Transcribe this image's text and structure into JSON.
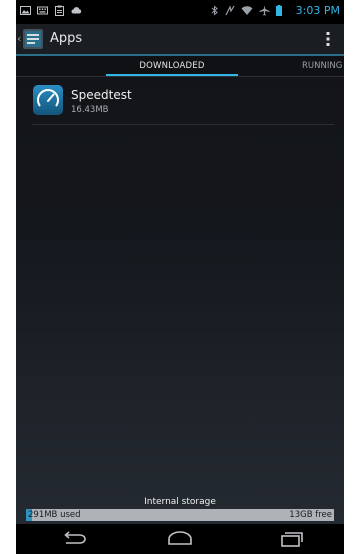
{
  "status_bar": {
    "time": "3:03 PM",
    "notification_icons": [
      "image-icon",
      "keyboard-icon",
      "clipboard-icon",
      "cloud-sync-icon"
    ],
    "system_icons": [
      "bluetooth-icon",
      "nfc-icon",
      "wifi-icon",
      "airplane-icon",
      "battery-icon"
    ]
  },
  "action_bar": {
    "title": "Apps"
  },
  "tabs": [
    {
      "label": "DOWNLOADED",
      "selected": true
    },
    {
      "label": "RUNNING",
      "selected": false
    }
  ],
  "apps": [
    {
      "name": "Speedtest",
      "size": "16.43MB",
      "icon": "speedometer-icon"
    }
  ],
  "storage": {
    "label": "Internal storage",
    "used": "291MB used",
    "free": "13GB free",
    "used_fraction": 0.02
  },
  "colors": {
    "accent": "#33b5e5",
    "storage_fill": "#2f94bf"
  },
  "nav_bar": [
    "back-icon",
    "home-icon",
    "recents-icon"
  ]
}
